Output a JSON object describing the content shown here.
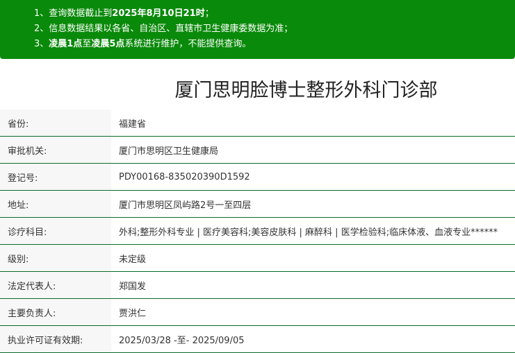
{
  "notice": {
    "line1_prefix": "1、查询数据截止到",
    "line1_bold": "2025年8月10日21时",
    "line1_suffix": "；",
    "line2": "2、信息数据结果以各省、自治区、直辖市卫生健康委数据为准；",
    "line3_prefix": "3、",
    "line3_bold1": "凌晨1点",
    "line3_mid": "至",
    "line3_bold2": "凌晨5点",
    "line3_suffix": "系统进行维护，不能提供查询。",
    "bg_color": "#0a8a0a"
  },
  "title": "厦门思明脸博士整形外科门诊部",
  "rows": [
    {
      "label": "省份:",
      "value": "福建省"
    },
    {
      "label": "审批机关:",
      "value": "厦门市思明区卫生健康局"
    },
    {
      "label": "登记号:",
      "value": "PDY00168-835020390D1592"
    },
    {
      "label": "地址:",
      "value": "厦门市思明区凤屿路2号一至四层"
    },
    {
      "label": "诊疗科目:",
      "value": "外科;整形外科专业 | 医疗美容科;美容皮肤科 | 麻醉科 | 医学检验科;临床体液、血液专业******"
    },
    {
      "label": "级别:",
      "value": "未定级"
    },
    {
      "label": "法定代表人:",
      "value": "郑国发"
    },
    {
      "label": "主要负责人:",
      "value": "贾洪仁"
    },
    {
      "label": "执业许可证有效期:",
      "value": "2025/03/28 -至- 2025/09/05"
    }
  ]
}
